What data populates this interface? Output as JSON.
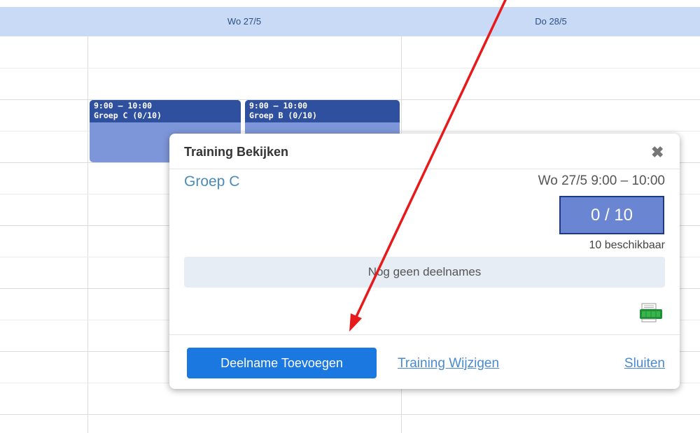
{
  "calendar": {
    "days": [
      "Wo 27/5",
      "Do 28/5"
    ]
  },
  "events": [
    {
      "time": "9:00 – 10:00",
      "title": "Groep C (0/10)"
    },
    {
      "time": "9:00 – 10:00",
      "title": "Groep B (0/10)"
    }
  ],
  "modal": {
    "title": "Training Bekijken",
    "close_icon": "close-icon",
    "group_name": "Groep C",
    "date_time": "Wo 27/5  9:00 – 10:00",
    "capacity": "0 / 10",
    "available": "10 beschikbaar",
    "no_participants": "Nog geen deelnames",
    "excel_icon": "excel-export-icon",
    "add_button": "Deelname Toevoegen",
    "edit_link": "Training Wijzigen",
    "close_link": "Sluiten"
  },
  "annotation": {
    "arrow_color": "#e8191a"
  },
  "colors": {
    "header_bg": "#c8daf5",
    "event_dark": "#2f4f9f",
    "event_light": "#7d96d9",
    "primary_button": "#1a78e0",
    "link": "#4a8bd0"
  }
}
